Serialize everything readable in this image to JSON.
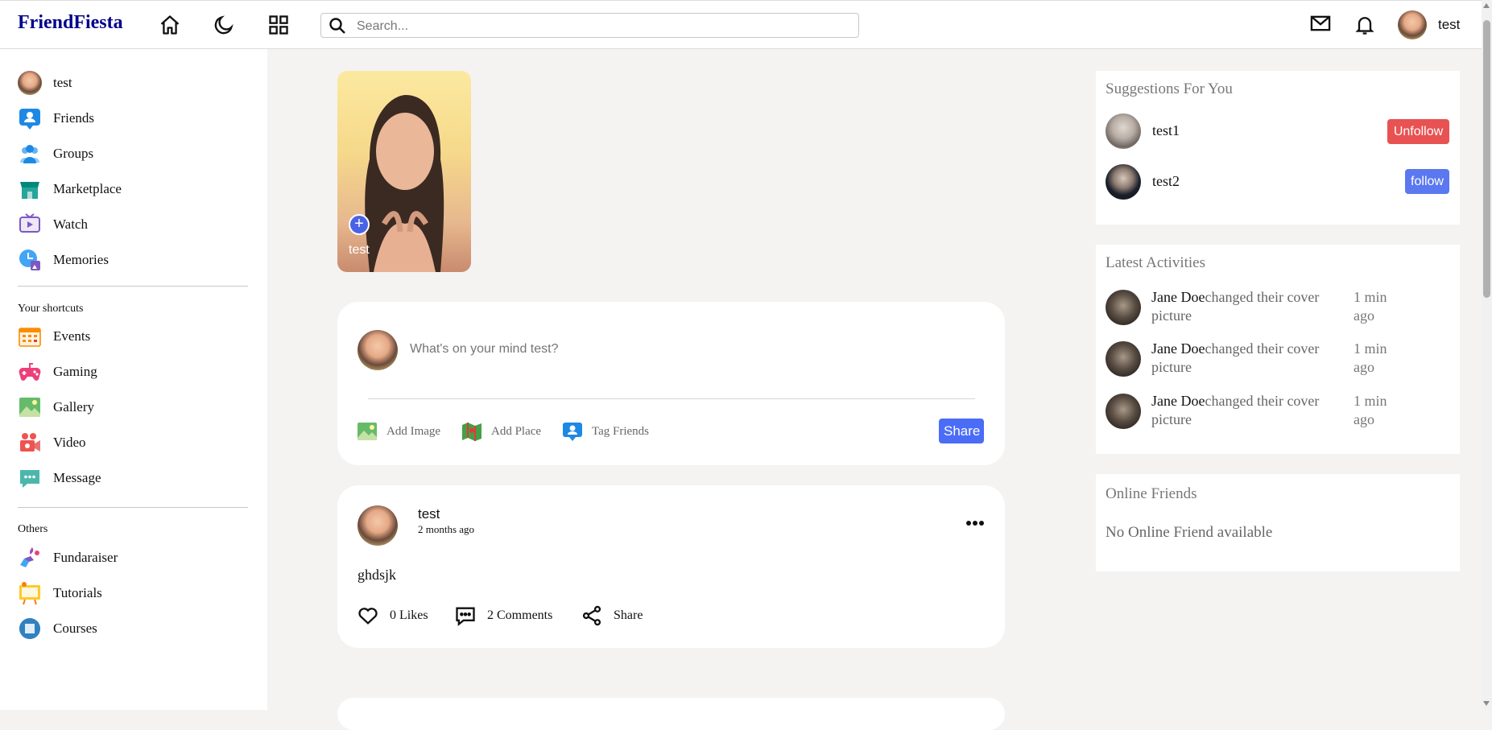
{
  "app": {
    "logo": "FriendFiesta"
  },
  "topbar": {
    "search_placeholder": "Search...",
    "user_name": "test",
    "icons": [
      "home-icon",
      "moon-icon",
      "grid-icon",
      "mail-icon",
      "bell-icon"
    ]
  },
  "sidebar": {
    "user": "test",
    "main": [
      {
        "label": "Friends",
        "icon": "friends-icon"
      },
      {
        "label": "Groups",
        "icon": "groups-icon"
      },
      {
        "label": "Marketplace",
        "icon": "marketplace-icon"
      },
      {
        "label": "Watch",
        "icon": "watch-icon"
      },
      {
        "label": "Memories",
        "icon": "memories-icon"
      }
    ],
    "shortcuts_heading": "Your shortcuts",
    "shortcuts": [
      {
        "label": "Events",
        "icon": "events-icon"
      },
      {
        "label": "Gaming",
        "icon": "gaming-icon"
      },
      {
        "label": "Gallery",
        "icon": "gallery-icon"
      },
      {
        "label": "Video",
        "icon": "video-icon"
      },
      {
        "label": "Message",
        "icon": "message-icon"
      }
    ],
    "others_heading": "Others",
    "others": [
      {
        "label": "Fundaraiser",
        "icon": "fundraiser-icon"
      },
      {
        "label": "Tutorials",
        "icon": "tutorials-icon"
      },
      {
        "label": "Courses",
        "icon": "courses-icon"
      }
    ]
  },
  "story": {
    "name": "test",
    "plus": "+"
  },
  "composer": {
    "placeholder": "What's on your mind test?",
    "add_image": "Add Image",
    "add_place": "Add Place",
    "tag_friends": "Tag Friends",
    "share": "Share"
  },
  "post": {
    "author": "test",
    "time": "2 months ago",
    "text": "ghdsjk",
    "likes": "0 Likes",
    "comments": "2 Comments",
    "share": "Share"
  },
  "suggestions": {
    "title": "Suggestions For You",
    "items": [
      {
        "name": "test1",
        "button": "Unfollow"
      },
      {
        "name": "test2",
        "button": "follow"
      }
    ]
  },
  "activities": {
    "title": "Latest Activities",
    "items": [
      {
        "name": "Jane Doe",
        "action": "changed their cover picture",
        "time": "1 min ago"
      },
      {
        "name": "Jane Doe",
        "action": "changed their cover picture",
        "time": "1 min ago"
      },
      {
        "name": "Jane Doe",
        "action": "changed their cover picture",
        "time": "1 min ago"
      }
    ]
  },
  "online": {
    "title": "Online Friends",
    "empty": "No Online Friend available"
  },
  "colors": {
    "logo": "#00008b",
    "share_button": "#4a6cf7",
    "unfollow_button": "#e85252",
    "follow_button": "#5b78f0",
    "page_bg": "#f4f3f2"
  }
}
